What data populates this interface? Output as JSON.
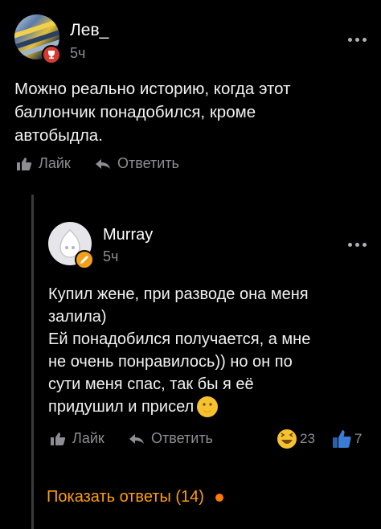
{
  "comment": {
    "username": "Лев_",
    "time": "5ч",
    "text_lines": [
      "Можно реально историю, когда этот",
      "баллончик понадобился, кроме",
      "автобыдла."
    ],
    "like_label": "Лайк",
    "reply_label": "Ответить"
  },
  "reply": {
    "username": "Murray",
    "time": "5ч",
    "text_lines": [
      "Купил жене, при разводе она меня",
      "залила)",
      "Ей понадобился получается, а мне",
      "не очень понравилось)) но он по",
      "сути меня спас, так бы я её",
      "придушил и присел"
    ],
    "like_label": "Лайк",
    "reply_label": "Ответить",
    "laugh_count": "23",
    "thumbs_count": "7"
  },
  "show_replies_label": "Показать ответы (14)",
  "colors": {
    "background": "#000000",
    "secondary_text": "#8d8d93",
    "accent_orange": "#ff9f0a",
    "thumbs_blue": "#3a7bd5"
  }
}
